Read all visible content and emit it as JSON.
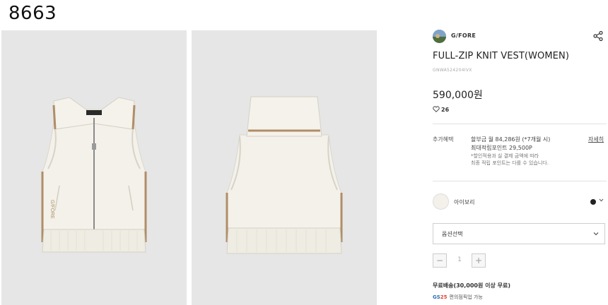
{
  "header": {
    "id_label": "8663"
  },
  "brand": {
    "name": "G/FORE"
  },
  "product": {
    "title": "FULL-ZIP KNIT VEST(WOMEN)",
    "sku": "GNWA524204IVX",
    "price": "590,000원",
    "likes": "26"
  },
  "benefits": {
    "label": "추가혜택",
    "line1": "할부금 월 84,286원 (*7개월 시)",
    "line2": "최대적립포인트 29,500P",
    "note1": "*할인적용과 실 결제 금액에 따라",
    "note2": "최종 적립 포인트는 다를 수 있습니다.",
    "detail_link": "자세히"
  },
  "color": {
    "name": "아이보리",
    "swatch": "#f3f1ea",
    "selected_dot": "#222222"
  },
  "option": {
    "label": "옵션선택"
  },
  "quantity": {
    "minus": "−",
    "value": "1",
    "plus": "+"
  },
  "shipping": {
    "text": "무료배송(30,000원 이상 무료)",
    "pickup": "편의점픽업 가능",
    "gs_logo_a": "GS",
    "gs_logo_b": "25"
  },
  "images": [
    {
      "name": "vest-front",
      "logo_text": "G/FORE",
      "side_text": "G/FORE"
    },
    {
      "name": "vest-back"
    }
  ]
}
